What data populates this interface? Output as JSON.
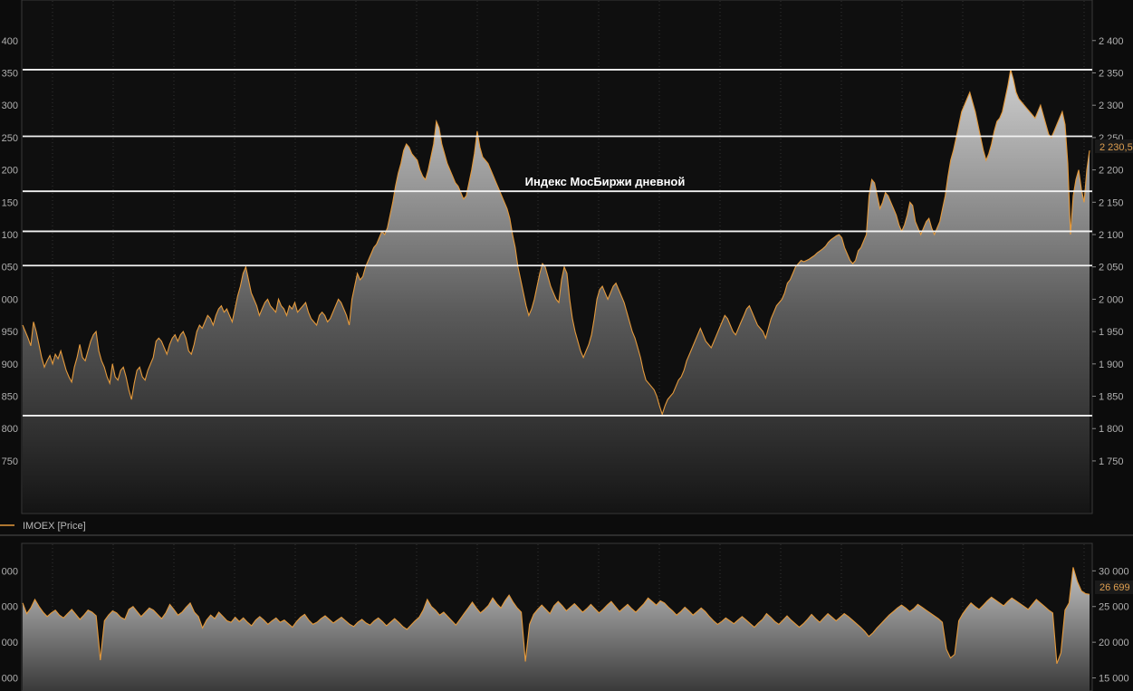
{
  "chart_data": [
    {
      "type": "area",
      "panel": "price",
      "title": "",
      "annotation": "Индекс МосБиржи дневной",
      "legend_label": "IMOEX [Price]",
      "ylim": [
        1710,
        2420
      ],
      "y_ticks": [
        "1 750",
        "1 800",
        "1 850",
        "1 900",
        "1 950",
        "2 000",
        "2 050",
        "2 100",
        "2 150",
        "2 200",
        "2 250",
        "2 300",
        "2 350",
        "2 400"
      ],
      "left_axis_ticks": [
        "750",
        "800",
        "850",
        "900",
        "950",
        "000",
        "050",
        "100",
        "150",
        "200",
        "250",
        "300",
        "350",
        "400"
      ],
      "last_value_label": "2 230,5",
      "last_value": 2230.5,
      "horizontal_levels": [
        2355,
        2252,
        2167,
        2105,
        2052,
        1820
      ],
      "values": [
        1960,
        1950,
        1940,
        1928,
        1965,
        1950,
        1930,
        1910,
        1895,
        1905,
        1913,
        1900,
        1915,
        1908,
        1920,
        1905,
        1890,
        1880,
        1872,
        1895,
        1910,
        1930,
        1910,
        1905,
        1920,
        1935,
        1945,
        1950,
        1920,
        1905,
        1895,
        1880,
        1870,
        1900,
        1880,
        1875,
        1890,
        1895,
        1880,
        1860,
        1845,
        1870,
        1890,
        1895,
        1880,
        1875,
        1890,
        1900,
        1910,
        1935,
        1940,
        1935,
        1925,
        1915,
        1930,
        1940,
        1945,
        1935,
        1945,
        1950,
        1940,
        1920,
        1915,
        1930,
        1950,
        1960,
        1955,
        1965,
        1975,
        1970,
        1960,
        1975,
        1985,
        1990,
        1980,
        1985,
        1975,
        1965,
        1985,
        2005,
        2020,
        2040,
        2050,
        2030,
        2010,
        2000,
        1990,
        1975,
        1985,
        1995,
        2000,
        1990,
        1985,
        1980,
        2000,
        1990,
        1985,
        1975,
        1990,
        1985,
        1995,
        1980,
        1985,
        1990,
        1995,
        1980,
        1970,
        1965,
        1960,
        1975,
        1980,
        1975,
        1965,
        1970,
        1980,
        1990,
        2000,
        1995,
        1985,
        1975,
        1960,
        2000,
        2020,
        2040,
        2030,
        2035,
        2050,
        2060,
        2070,
        2080,
        2085,
        2095,
        2105,
        2100,
        2110,
        2130,
        2150,
        2175,
        2195,
        2210,
        2230,
        2240,
        2235,
        2225,
        2220,
        2215,
        2200,
        2190,
        2185,
        2200,
        2220,
        2240,
        2275,
        2265,
        2240,
        2225,
        2210,
        2200,
        2190,
        2180,
        2175,
        2165,
        2155,
        2160,
        2180,
        2200,
        2225,
        2260,
        2235,
        2220,
        2215,
        2210,
        2200,
        2190,
        2180,
        2170,
        2160,
        2150,
        2140,
        2125,
        2100,
        2080,
        2050,
        2030,
        2010,
        1990,
        1975,
        1985,
        2000,
        2020,
        2040,
        2055,
        2050,
        2035,
        2020,
        2010,
        2000,
        1995,
        2030,
        2050,
        2040,
        2000,
        1970,
        1950,
        1935,
        1920,
        1910,
        1920,
        1930,
        1945,
        1970,
        2000,
        2015,
        2020,
        2010,
        2000,
        2010,
        2020,
        2025,
        2015,
        2005,
        1995,
        1980,
        1965,
        1950,
        1940,
        1925,
        1910,
        1890,
        1875,
        1870,
        1865,
        1860,
        1850,
        1835,
        1822,
        1835,
        1845,
        1850,
        1855,
        1865,
        1875,
        1880,
        1890,
        1905,
        1915,
        1925,
        1935,
        1945,
        1955,
        1945,
        1935,
        1930,
        1925,
        1935,
        1945,
        1955,
        1965,
        1975,
        1970,
        1960,
        1950,
        1945,
        1955,
        1965,
        1975,
        1985,
        1990,
        1980,
        1970,
        1960,
        1955,
        1950,
        1940,
        1955,
        1970,
        1980,
        1990,
        1995,
        2000,
        2010,
        2025,
        2030,
        2040,
        2050,
        2055,
        2060,
        2058,
        2060,
        2062,
        2065,
        2068,
        2072,
        2075,
        2078,
        2082,
        2088,
        2092,
        2095,
        2098,
        2100,
        2095,
        2080,
        2070,
        2060,
        2055,
        2060,
        2075,
        2080,
        2090,
        2100,
        2160,
        2185,
        2180,
        2160,
        2140,
        2150,
        2165,
        2160,
        2150,
        2140,
        2130,
        2115,
        2105,
        2115,
        2130,
        2150,
        2145,
        2120,
        2110,
        2100,
        2110,
        2120,
        2125,
        2110,
        2100,
        2110,
        2120,
        2140,
        2160,
        2190,
        2215,
        2230,
        2250,
        2270,
        2290,
        2300,
        2310,
        2320,
        2305,
        2290,
        2270,
        2250,
        2230,
        2215,
        2225,
        2240,
        2260,
        2275,
        2280,
        2290,
        2310,
        2330,
        2355,
        2340,
        2320,
        2310,
        2305,
        2300,
        2295,
        2290,
        2285,
        2280,
        2290,
        2300,
        2285,
        2270,
        2255,
        2250,
        2260,
        2270,
        2280,
        2290,
        2270,
        2210,
        2100,
        2160,
        2185,
        2200,
        2170,
        2150,
        2200,
        2230
      ]
    },
    {
      "type": "area",
      "panel": "lower",
      "ylim": [
        14500,
        31500
      ],
      "y_ticks": [
        "15 000",
        "20 000",
        "25 000",
        "30 000"
      ],
      "left_axis_ticks": [
        "000",
        "000",
        "000",
        "000"
      ],
      "last_value_label": "26 699",
      "last_value": 26699,
      "values": [
        25500,
        24000,
        24800,
        26000,
        25000,
        24200,
        23600,
        24100,
        24500,
        23800,
        23400,
        24000,
        24600,
        23900,
        23200,
        23800,
        24500,
        24200,
        23700,
        17500,
        23000,
        23800,
        24400,
        24100,
        23500,
        23200,
        24600,
        25000,
        24300,
        23600,
        24200,
        24800,
        24500,
        23900,
        23300,
        24100,
        25300,
        24600,
        23800,
        24200,
        24900,
        25500,
        24200,
        23600,
        22000,
        23100,
        23800,
        23300,
        24200,
        23600,
        23000,
        22800,
        23500,
        22900,
        23400,
        22800,
        22300,
        23100,
        23600,
        23100,
        22500,
        23000,
        23400,
        22800,
        23100,
        22600,
        22100,
        22900,
        23500,
        23900,
        23100,
        22500,
        22800,
        23300,
        23700,
        23200,
        22700,
        23100,
        23500,
        23000,
        22500,
        22200,
        22800,
        23200,
        22700,
        22400,
        23000,
        23400,
        22900,
        22300,
        22800,
        23300,
        22800,
        22200,
        21800,
        22400,
        23000,
        23500,
        24500,
        26000,
        25000,
        24500,
        23800,
        24200,
        23600,
        23000,
        22400,
        23200,
        24000,
        24800,
        25600,
        24800,
        24100,
        24600,
        25200,
        26200,
        25400,
        24800,
        25800,
        26600,
        25600,
        24800,
        24200,
        17300,
        22500,
        23900,
        24600,
        25200,
        24600,
        24000,
        25100,
        25700,
        25100,
        24400,
        24900,
        25400,
        24800,
        24200,
        24700,
        25300,
        24700,
        24100,
        24600,
        25200,
        25700,
        25000,
        24300,
        24800,
        25300,
        24700,
        24200,
        24800,
        25400,
        26200,
        25700,
        25200,
        25800,
        25500,
        24900,
        24400,
        23800,
        24300,
        24900,
        24400,
        23800,
        24300,
        24800,
        24300,
        23600,
        23000,
        22500,
        22900,
        23400,
        23000,
        22600,
        23100,
        23600,
        23100,
        22600,
        22100,
        22700,
        23200,
        24000,
        23500,
        22900,
        22500,
        23100,
        23700,
        23100,
        22600,
        22100,
        22600,
        23200,
        23900,
        23300,
        22800,
        23400,
        24000,
        23500,
        23000,
        23500,
        24000,
        23600,
        23100,
        22600,
        22100,
        21500,
        20800,
        21300,
        22000,
        22600,
        23200,
        23800,
        24300,
        24800,
        25200,
        24800,
        24300,
        24700,
        25300,
        24900,
        24500,
        24100,
        23700,
        23300,
        22800,
        19000,
        17800,
        18300,
        23000,
        24000,
        24800,
        25500,
        25000,
        24600,
        25200,
        25800,
        26300,
        25900,
        25500,
        25100,
        25700,
        26200,
        25800,
        25400,
        25000,
        24600,
        25300,
        26000,
        25500,
        25000,
        24500,
        24100,
        17000,
        18500,
        24500,
        25500,
        30500,
        28500,
        27200,
        26800,
        26700
      ]
    }
  ]
}
